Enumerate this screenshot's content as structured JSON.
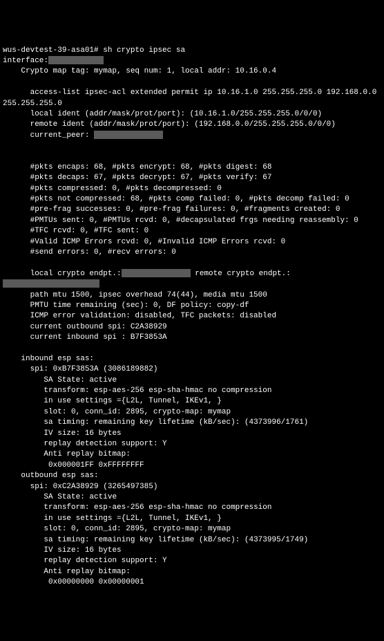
{
  "prompt": {
    "hostname": "wus-devtest-39-asa01#",
    "command": "sh crypto ipsec sa"
  },
  "output": {
    "interface_label": "interface:",
    "crypto_map": "    Crypto map tag: mymap, seq num: 1, local addr: 10.16.0.4",
    "access_list": "      access-list ipsec-acl extended permit ip 10.16.1.0 255.255.255.0 192.168.0.0 255.255.255.0",
    "local_ident": "      local ident (addr/mask/prot/port): (10.16.1.0/255.255.255.0/0/0)",
    "remote_ident": "      remote ident (addr/mask/prot/port): (192.168.0.0/255.255.255.0/0/0)",
    "current_peer_label": "      current_peer:",
    "pkts_encaps": "      #pkts encaps: 68, #pkts encrypt: 68, #pkts digest: 68",
    "pkts_decaps": "      #pkts decaps: 67, #pkts decrypt: 67, #pkts verify: 67",
    "pkts_compressed": "      #pkts compressed: 0, #pkts decompressed: 0",
    "pkts_not_compressed": "      #pkts not compressed: 68, #pkts comp failed: 0, #pkts decomp failed: 0",
    "pre_frag": "      #pre-frag successes: 0, #pre-frag failures: 0, #fragments created: 0",
    "pmtus": "      #PMTUs sent: 0, #PMTUs rcvd: 0, #decapsulated frgs needing reassembly: 0",
    "tfc": "      #TFC rcvd: 0, #TFC sent: 0",
    "valid_icmp": "      #Valid ICMP Errors rcvd: 0, #Invalid ICMP Errors rcvd: 0",
    "send_errors": "      #send errors: 0, #recv errors: 0",
    "local_crypto_label": "      local crypto endpt.:",
    "remote_crypto_label": " remote crypto endpt.:",
    "path_mtu": "      path mtu 1500, ipsec overhead 74(44), media mtu 1500",
    "pmtu_time": "      PMTU time remaining (sec): 0, DF policy: copy-df",
    "icmp_error": "      ICMP error validation: disabled, TFC packets: disabled",
    "current_outbound": "      current outbound spi: C2A38929",
    "current_inbound": "      current inbound spi : B7F3853A",
    "inbound_header": "    inbound esp sas:",
    "inbound_spi": "      spi: 0xB7F3853A (3086189882)",
    "in_sa_state": "         SA State: active",
    "in_transform": "         transform: esp-aes-256 esp-sha-hmac no compression",
    "in_settings": "         in use settings ={L2L, Tunnel, IKEv1, }",
    "in_slot": "         slot: 0, conn_id: 2895, crypto-map: mymap",
    "in_sa_timing": "         sa timing: remaining key lifetime (kB/sec): (4373996/1761)",
    "in_iv": "         IV size: 16 bytes",
    "in_replay": "         replay detection support: Y",
    "in_anti_replay": "         Anti replay bitmap:",
    "in_bitmap": "          0x000001FF 0xFFFFFFFF",
    "outbound_header": "    outbound esp sas:",
    "outbound_spi": "      spi: 0xC2A38929 (3265497385)",
    "out_sa_state": "         SA State: active",
    "out_transform": "         transform: esp-aes-256 esp-sha-hmac no compression",
    "out_settings": "         in use settings ={L2L, Tunnel, IKEv1, }",
    "out_slot": "         slot: 0, conn_id: 2895, crypto-map: mymap",
    "out_sa_timing": "         sa timing: remaining key lifetime (kB/sec): (4373995/1749)",
    "out_iv": "         IV size: 16 bytes",
    "out_replay": "         replay detection support: Y",
    "out_anti_replay": "         Anti replay bitmap:",
    "out_bitmap": "          0x00000000 0x00000001"
  }
}
